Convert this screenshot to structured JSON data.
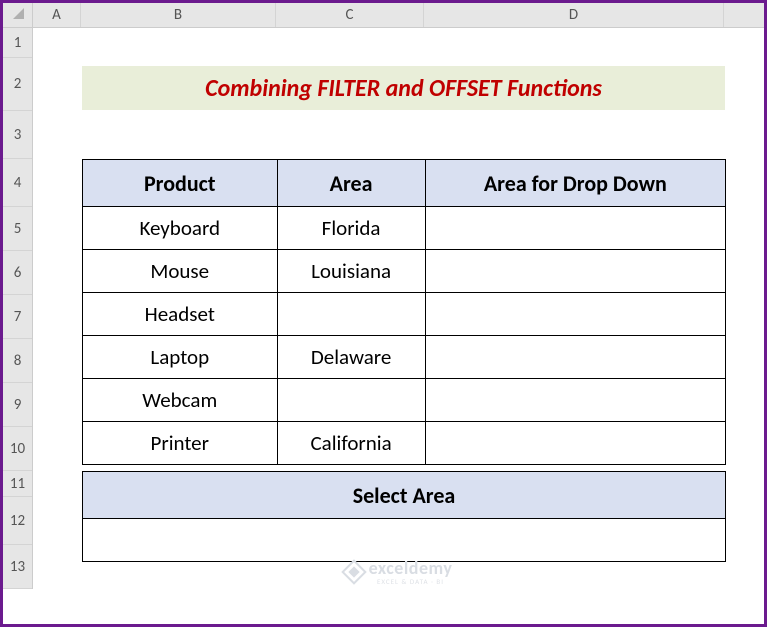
{
  "columns": {
    "A": "A",
    "B": "B",
    "C": "C",
    "D": "D"
  },
  "rows": {
    "r1": "1",
    "r2": "2",
    "r3": "3",
    "r4": "4",
    "r5": "5",
    "r6": "6",
    "r7": "7",
    "r8": "8",
    "r9": "9",
    "r10": "10",
    "r11": "11",
    "r12": "12",
    "r13": "13"
  },
  "title": "Combining FILTER and OFFSET Functions",
  "table1": {
    "headers": {
      "product": "Product",
      "area": "Area",
      "dropdown": "Area for Drop Down"
    },
    "rows": [
      {
        "product": "Keyboard",
        "area": "Florida",
        "dropdown": ""
      },
      {
        "product": "Mouse",
        "area": "Louisiana",
        "dropdown": ""
      },
      {
        "product": "Headset",
        "area": "",
        "dropdown": ""
      },
      {
        "product": "Laptop",
        "area": "Delaware",
        "dropdown": ""
      },
      {
        "product": "Webcam",
        "area": "",
        "dropdown": ""
      },
      {
        "product": "Printer",
        "area": "California",
        "dropdown": ""
      }
    ]
  },
  "table2": {
    "header": "Select Area",
    "value": ""
  },
  "watermark": {
    "brand": "exceldemy",
    "tagline": "EXCEL & DATA · BI"
  },
  "layout": {
    "colWidths": {
      "A": 48,
      "B": 195,
      "C": 148,
      "D": 300
    },
    "rowHeights": {
      "r1": 30,
      "r2": 53,
      "r3": 48,
      "r4": 48,
      "r5": 44,
      "r6": 44,
      "r7": 44,
      "r8": 44,
      "r9": 44,
      "r10": 44,
      "r11": 26,
      "r12": 48,
      "r13": 44
    }
  }
}
